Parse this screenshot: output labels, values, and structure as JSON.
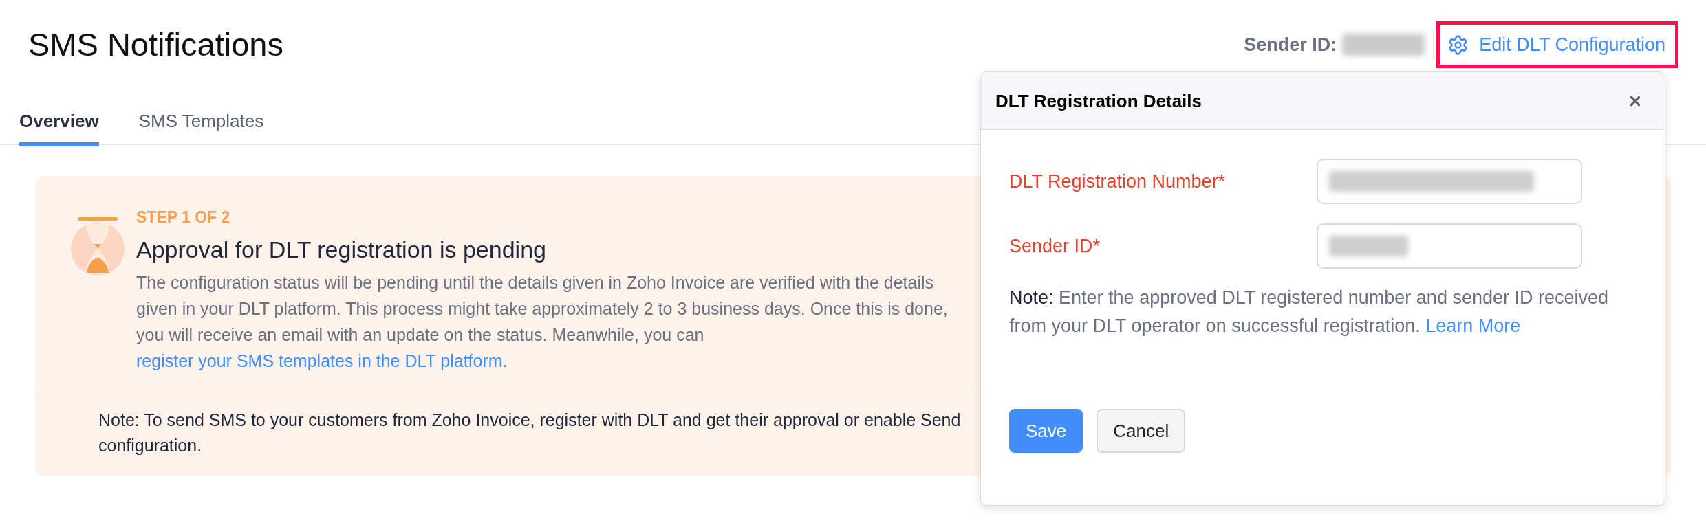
{
  "header": {
    "title": "SMS Notifications",
    "sender_id": {
      "label": "Sender ID:",
      "blurred": true
    },
    "edit_link": {
      "label": "Edit DLT Configuration",
      "highlighted": true
    }
  },
  "tabs": [
    {
      "label": "Overview",
      "selected": true
    },
    {
      "label": "SMS Templates",
      "selected": false
    }
  ],
  "status_card": {
    "step": "STEP 1 OF 2",
    "title": "Approval for DLT registration is pending",
    "description": "The configuration status will be pending until the details given in Zoho Invoice are verified with the details given in your DLT platform. This process might take approximately 2 to 3 business days. Once this is done, you will receive an email with an update on the status. Meanwhile, you can",
    "description_link": "register your SMS templates in the DLT platform",
    "description_end": ".",
    "note": "Note: To send SMS to your customers from Zoho Invoice, register with DLT and get their approval or enable Send configuration."
  },
  "dialog": {
    "title": "DLT Registration Details",
    "fields": [
      {
        "label": "DLT Registration Number*",
        "required": true,
        "blurred": true
      },
      {
        "label": "Sender ID*",
        "required": true,
        "blurred": true
      }
    ],
    "note_label": "Note:",
    "note": "Enter the approved DLT registered number and sender ID received from your DLT operator on successful registration.",
    "note_link": "Learn More",
    "buttons": [
      {
        "label": "Save",
        "kind": "primary"
      },
      {
        "label": "Cancel",
        "kind": "secondary"
      }
    ]
  }
}
